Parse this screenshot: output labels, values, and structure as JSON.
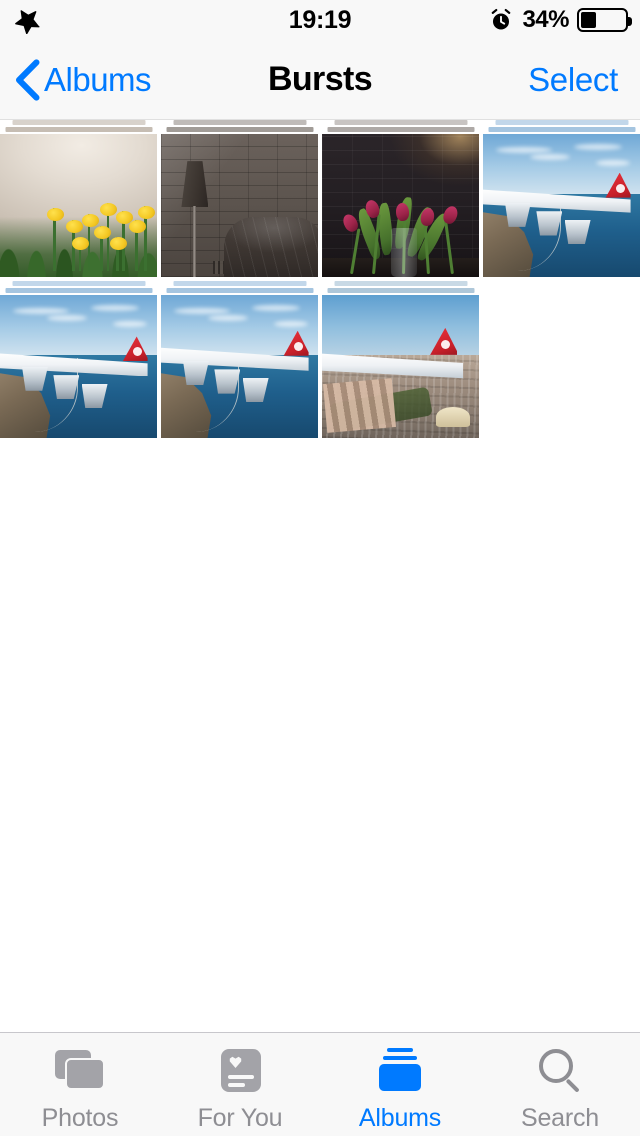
{
  "status_bar": {
    "airplane_mode_icon": "airplane-icon",
    "time": "19:19",
    "alarm_icon": "alarm-clock-icon",
    "battery_percent": "34%",
    "battery_level": 34
  },
  "nav_bar": {
    "back_icon": "chevron-left-icon",
    "back_label": "Albums",
    "title": "Bursts",
    "action_label": "Select",
    "accent_color": "#007aff",
    "background_color": "#f8f8f8"
  },
  "grid": {
    "columns": 4,
    "items": [
      {
        "name": "burst-daffodils",
        "scene": "sc-daffodil",
        "stack_color": "#b8ada0",
        "alt": "Yellow daffodils in front of a beige wall"
      },
      {
        "name": "burst-lamp-chair",
        "scene": "sc-lamp",
        "stack_color": "#8a837d",
        "alt": "Floor lamp and leather chair against a grey brick wall"
      },
      {
        "name": "burst-tulips",
        "scene": "sc-tulip",
        "stack_color": "#9a9490",
        "alt": "Pink tulips in a glass vase against a dark brick wall"
      },
      {
        "name": "burst-wing-sea-1",
        "scene": "sc-wing",
        "stack_color": "#8fb6d8",
        "alt": "Airplane wing over blue sea and coastline"
      },
      {
        "name": "burst-wing-sea-2",
        "scene": "sc-wing",
        "stack_color": "#8fb6d8",
        "alt": "Airplane wing over blue sea and coastline"
      },
      {
        "name": "burst-wing-sea-3",
        "scene": "sc-wing",
        "stack_color": "#8fb6d8",
        "alt": "Airplane wing over blue sea and coastline"
      },
      {
        "name": "burst-wing-city",
        "scene": "sc-city",
        "stack_color": "#9ab9d0",
        "alt": "Airplane wing over a city landscape"
      }
    ]
  },
  "tab_bar": {
    "items": [
      {
        "icon": "photos-icon",
        "label": "Photos",
        "active": false
      },
      {
        "icon": "for-you-icon",
        "label": "For You",
        "active": false
      },
      {
        "icon": "albums-icon",
        "label": "Albums",
        "active": true
      },
      {
        "icon": "search-icon",
        "label": "Search",
        "active": false
      }
    ],
    "active_color": "#007aff",
    "inactive_color": "#8e8e93"
  }
}
